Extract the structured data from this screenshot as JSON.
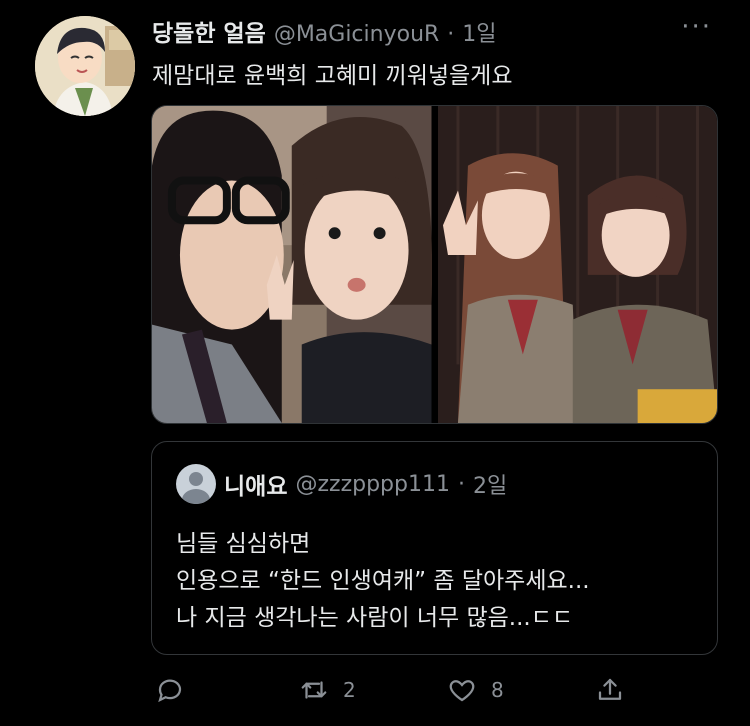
{
  "tweet": {
    "display_name": "당돌한 얼음",
    "handle": "@MaGicinyouR",
    "separator": "·",
    "time": "1일",
    "more_label": "···",
    "text": "제맘대로 윤백희 고혜미 끼워넣을게요"
  },
  "quote": {
    "display_name": "니애요",
    "handle": "@zzzpppp111",
    "separator": "·",
    "time": "2일",
    "lines": [
      "님들 심심하면",
      "인용으로 “한드 인생여캐” 좀 달아주세요...",
      "나 지금 생각나는 사람이 너무 많음...ㄷㄷ"
    ]
  },
  "actions": {
    "reply_icon": "reply-icon",
    "retweet_count": "2",
    "like_count": "8",
    "share_icon": "share-icon"
  },
  "colors": {
    "background": "#000000",
    "text_primary": "#e7e9ea",
    "text_secondary": "#8b9096",
    "border": "#2f3336"
  }
}
